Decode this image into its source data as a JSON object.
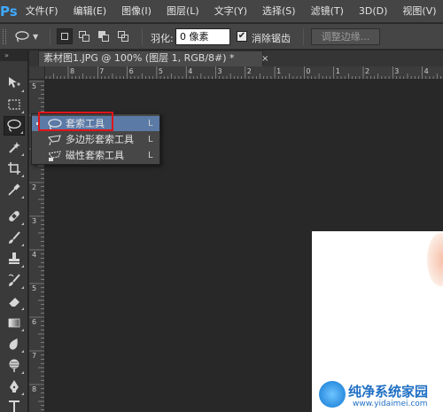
{
  "app": {
    "logo_text": "Ps"
  },
  "menu": [
    {
      "label": "文件(F)"
    },
    {
      "label": "编辑(E)"
    },
    {
      "label": "图像(I)"
    },
    {
      "label": "图层(L)"
    },
    {
      "label": "文字(Y)"
    },
    {
      "label": "选择(S)"
    },
    {
      "label": "滤镜(T)"
    },
    {
      "label": "3D(D)"
    },
    {
      "label": "视图(V)"
    }
  ],
  "options_bar": {
    "feather_label": "羽化:",
    "feather_value": "0 像素",
    "anti_alias_label": "消除锯齿",
    "anti_alias_checked": true,
    "refine_edge_label": "调整边缘..."
  },
  "toolbar": {
    "collapse_glyph": "»"
  },
  "document": {
    "tab_title": "素材图1.JPG @ 100% (图层 1, RGB/8#) *",
    "close_glyph": "×"
  },
  "rulers": {
    "horizontal": [
      "8",
      "7",
      "6",
      "5",
      "4",
      "3",
      "2",
      "1",
      "0",
      "1",
      "2",
      "3",
      "4",
      "5"
    ],
    "vertical": [
      "5",
      "0",
      "1",
      "2",
      "3",
      "4",
      "5",
      "6",
      "7",
      "8"
    ]
  },
  "flyout": {
    "items": [
      {
        "label": "套索工具",
        "shortcut": "L",
        "icon": "lasso-icon",
        "selected": true
      },
      {
        "label": "多边形套索工具",
        "shortcut": "L",
        "icon": "polygonal-lasso-icon",
        "selected": false
      },
      {
        "label": "磁性套索工具",
        "shortcut": "L",
        "icon": "magnetic-lasso-icon",
        "selected": false
      }
    ]
  },
  "watermark": {
    "title": "纯净系统家园",
    "url": "www.yidaimei.com"
  },
  "colors": {
    "ps_blue": "#3ea8ff",
    "highlight_box": "#e0141a",
    "selected_item": "#5b7aa6"
  }
}
